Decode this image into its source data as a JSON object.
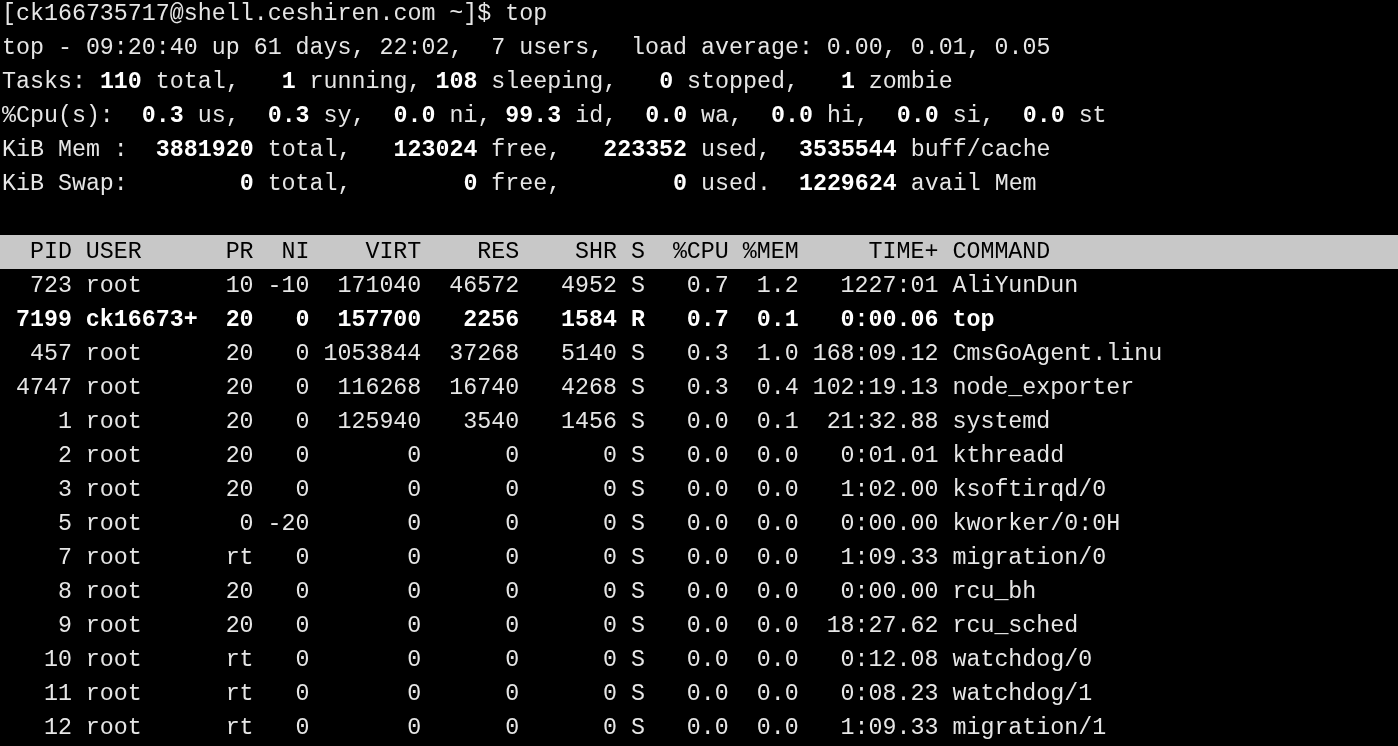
{
  "prompt": "[ck166735717@shell.ceshiren.com ~]$ top",
  "summary": [
    "top - 09:20:40 up 61 days, 22:02,  7 users,  load average: 0.00, 0.01, 0.05",
    "Tasks: **110** total,   **1** running, **108** sleeping,   **0** stopped,   **1** zombie",
    "%Cpu(s):  **0.3** us,  **0.3** sy,  **0.0** ni, **99.3** id,  **0.0** wa,  **0.0** hi,  **0.0** si,  **0.0** st",
    "KiB Mem :  **3881920** total,   **123024** free,   **223352** used,  **3535544** buff/cache",
    "KiB Swap:        **0** total,        **0** free,        **0** used.  **1229624** avail Mem"
  ],
  "table": {
    "columns": [
      "PID",
      "USER",
      "PR",
      "NI",
      "VIRT",
      "RES",
      "SHR",
      "S",
      "%CPU",
      "%MEM",
      "TIME+",
      "COMMAND"
    ],
    "rows": [
      {
        "highlighted": false,
        "cells": [
          "723",
          "root",
          "10",
          "-10",
          "171040",
          "46572",
          "4952",
          "S",
          "0.7",
          "1.2",
          "1227:01",
          "AliYunDun"
        ]
      },
      {
        "highlighted": true,
        "cells": [
          "7199",
          "ck16673+",
          "20",
          "0",
          "157700",
          "2256",
          "1584",
          "R",
          "0.7",
          "0.1",
          "0:00.06",
          "top"
        ]
      },
      {
        "highlighted": false,
        "cells": [
          "457",
          "root",
          "20",
          "0",
          "1053844",
          "37268",
          "5140",
          "S",
          "0.3",
          "1.0",
          "168:09.12",
          "CmsGoAgent.linu"
        ]
      },
      {
        "highlighted": false,
        "cells": [
          "4747",
          "root",
          "20",
          "0",
          "116268",
          "16740",
          "4268",
          "S",
          "0.3",
          "0.4",
          "102:19.13",
          "node_exporter"
        ]
      },
      {
        "highlighted": false,
        "cells": [
          "1",
          "root",
          "20",
          "0",
          "125940",
          "3540",
          "1456",
          "S",
          "0.0",
          "0.1",
          "21:32.88",
          "systemd"
        ]
      },
      {
        "highlighted": false,
        "cells": [
          "2",
          "root",
          "20",
          "0",
          "0",
          "0",
          "0",
          "S",
          "0.0",
          "0.0",
          "0:01.01",
          "kthreadd"
        ]
      },
      {
        "highlighted": false,
        "cells": [
          "3",
          "root",
          "20",
          "0",
          "0",
          "0",
          "0",
          "S",
          "0.0",
          "0.0",
          "1:02.00",
          "ksoftirqd/0"
        ]
      },
      {
        "highlighted": false,
        "cells": [
          "5",
          "root",
          "0",
          "-20",
          "0",
          "0",
          "0",
          "S",
          "0.0",
          "0.0",
          "0:00.00",
          "kworker/0:0H"
        ]
      },
      {
        "highlighted": false,
        "cells": [
          "7",
          "root",
          "rt",
          "0",
          "0",
          "0",
          "0",
          "S",
          "0.0",
          "0.0",
          "1:09.33",
          "migration/0"
        ]
      },
      {
        "highlighted": false,
        "cells": [
          "8",
          "root",
          "20",
          "0",
          "0",
          "0",
          "0",
          "S",
          "0.0",
          "0.0",
          "0:00.00",
          "rcu_bh"
        ]
      },
      {
        "highlighted": false,
        "cells": [
          "9",
          "root",
          "20",
          "0",
          "0",
          "0",
          "0",
          "S",
          "0.0",
          "0.0",
          "18:27.62",
          "rcu_sched"
        ]
      },
      {
        "highlighted": false,
        "cells": [
          "10",
          "root",
          "rt",
          "0",
          "0",
          "0",
          "0",
          "S",
          "0.0",
          "0.0",
          "0:12.08",
          "watchdog/0"
        ]
      },
      {
        "highlighted": false,
        "cells": [
          "11",
          "root",
          "rt",
          "0",
          "0",
          "0",
          "0",
          "S",
          "0.0",
          "0.0",
          "0:08.23",
          "watchdog/1"
        ]
      },
      {
        "highlighted": false,
        "cells": [
          "12",
          "root",
          "rt",
          "0",
          "0",
          "0",
          "0",
          "S",
          "0.0",
          "0.0",
          "1:09.33",
          "migration/1"
        ]
      }
    ]
  }
}
